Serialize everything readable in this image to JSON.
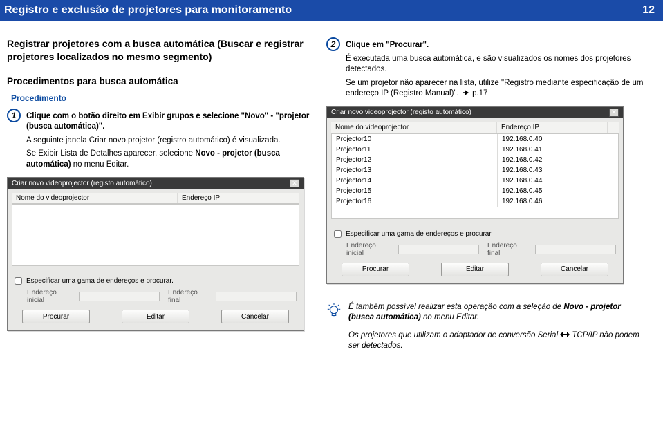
{
  "header": {
    "title": "Registro e exclusão de projetores para monitoramento",
    "page_number": "12"
  },
  "left": {
    "section_title": "Registrar projetores com a busca automática (Buscar e registrar projetores localizados no mesmo segmento)",
    "subsection_title": "Procedimentos para busca automática",
    "procedimento_label": "Procedimento",
    "step1": {
      "num": "1",
      "lead": "Clique com o botão direito em Exibir grupos e selecione \"Novo\" - \"projetor (busca automática)\".",
      "p1": "A seguinte janela Criar novo projetor (registro automático) é visualizada.",
      "p2_1": "Se Exibir Lista de Detalhes aparecer, selecione ",
      "p2_bold": "Novo - projetor (busca automática)",
      "p2_2": " no menu Editar."
    },
    "dialog1": {
      "title": "Criar novo videoprojector (registo automático)",
      "header_name": "Nome do videoprojector",
      "header_ip": "Endereço IP",
      "chk_label": "Especificar uma gama de endereços e procurar.",
      "range_start_label": "Endereço inicial",
      "range_end_label": "Endereço final",
      "btn_search": "Procurar",
      "btn_edit": "Editar",
      "btn_cancel": "Cancelar"
    }
  },
  "right": {
    "step2": {
      "num": "2",
      "lead": "Clique em \"Procurar\".",
      "p1": "É executada uma busca automática, e são visualizados os nomes dos projetores detectados.",
      "p2_1": "Se um projetor não aparecer na lista, utilize \"Registro mediante especificação de um endereço IP (Registro Manual)\". ",
      "p2_ref": "p.17"
    },
    "dialog2": {
      "title": "Criar novo videoprojector (registo automático)",
      "header_name": "Nome do videoprojector",
      "header_ip": "Endereço IP",
      "rows": [
        {
          "name": "Projector10",
          "ip": "192.168.0.40"
        },
        {
          "name": "Projector11",
          "ip": "192.168.0.41"
        },
        {
          "name": "Projector12",
          "ip": "192.168.0.42"
        },
        {
          "name": "Projector13",
          "ip": "192.168.0.43"
        },
        {
          "name": "Projector14",
          "ip": "192.168.0.44"
        },
        {
          "name": "Projector15",
          "ip": "192.168.0.45"
        },
        {
          "name": "Projector16",
          "ip": "192.168.0.46"
        }
      ],
      "chk_label": "Especificar uma gama de endereços e procurar.",
      "range_start_label": "Endereço inicial",
      "range_end_label": "Endereço final",
      "btn_search": "Procurar",
      "btn_edit": "Editar",
      "btn_cancel": "Cancelar"
    },
    "tip": {
      "p1_a": "É também possível realizar esta operação com a seleção de ",
      "p1_bold": "Novo - projetor (busca automática)",
      "p1_b": " no menu Editar.",
      "p2_a": "Os projetores que utilizam o adaptador de conversão Serial ",
      "p2_b": " TCP/IP não podem ser detectados."
    }
  }
}
